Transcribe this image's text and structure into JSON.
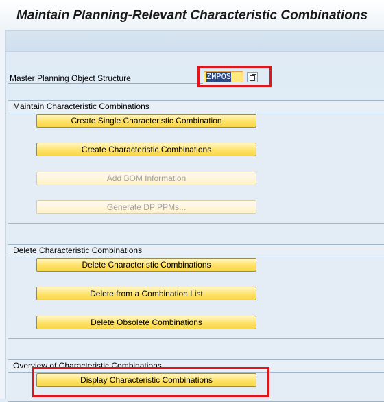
{
  "header": {
    "title": "Maintain Planning-Relevant Characteristic Combinations"
  },
  "field": {
    "label": "Master Planning Object Structure",
    "value": "ZMPOS"
  },
  "groups": {
    "maintain": {
      "title": "Maintain Characteristic Combinations",
      "buttons": [
        {
          "label": "Create Single Characteristic Combination",
          "enabled": true
        },
        {
          "label": "Create Characteristic Combinations",
          "enabled": true
        },
        {
          "label": "Add BOM Information",
          "enabled": false
        },
        {
          "label": "Generate DP PPMs...",
          "enabled": false
        }
      ]
    },
    "delete": {
      "title": "Delete Characteristic Combinations",
      "buttons": [
        {
          "label": "Delete Characteristic Combinations",
          "enabled": true
        },
        {
          "label": "Delete from a Combination List",
          "enabled": true
        },
        {
          "label": "Delete Obsolete Combinations",
          "enabled": true
        }
      ]
    },
    "overview": {
      "title": "Overview of Characteristic Combinations",
      "buttons": [
        {
          "label": "Display Characteristic Combinations",
          "enabled": true
        }
      ]
    }
  },
  "colors": {
    "highlight": "#e0151b",
    "button": "#ffe266",
    "input": "#ffe97a"
  }
}
